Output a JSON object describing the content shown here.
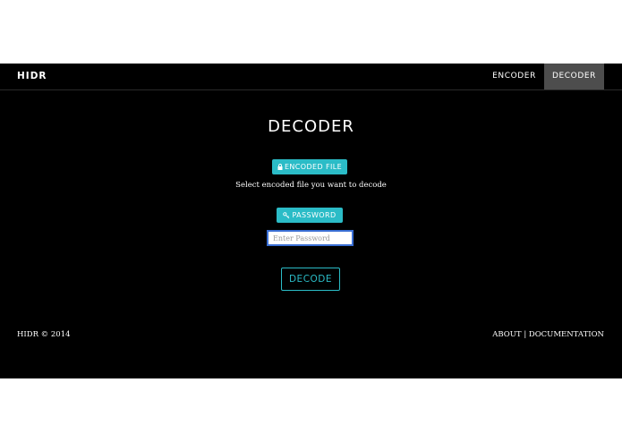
{
  "navbar": {
    "brand": "HIDR",
    "links": [
      {
        "label": "ENCODER",
        "active": false
      },
      {
        "label": "DECODER",
        "active": true
      }
    ]
  },
  "main": {
    "title": "DECODER",
    "file_button": {
      "icon": "lock-icon",
      "label": "ENCODED FILE"
    },
    "file_hint": "Select encoded file you want to decode",
    "password_button": {
      "icon": "key-icon",
      "label": "PASSWORD"
    },
    "password_input": {
      "placeholder": "Enter Password",
      "value": ""
    },
    "decode_button": "DECODE"
  },
  "footer": {
    "copyright": "HIDR © 2014",
    "about": "ABOUT",
    "separator": "|",
    "documentation": "DOCUMENTATION"
  },
  "colors": {
    "accent": "#2bbcc7",
    "background": "#000000",
    "nav_active": "#4d4d4d",
    "input_focus": "#3a6fd4"
  }
}
